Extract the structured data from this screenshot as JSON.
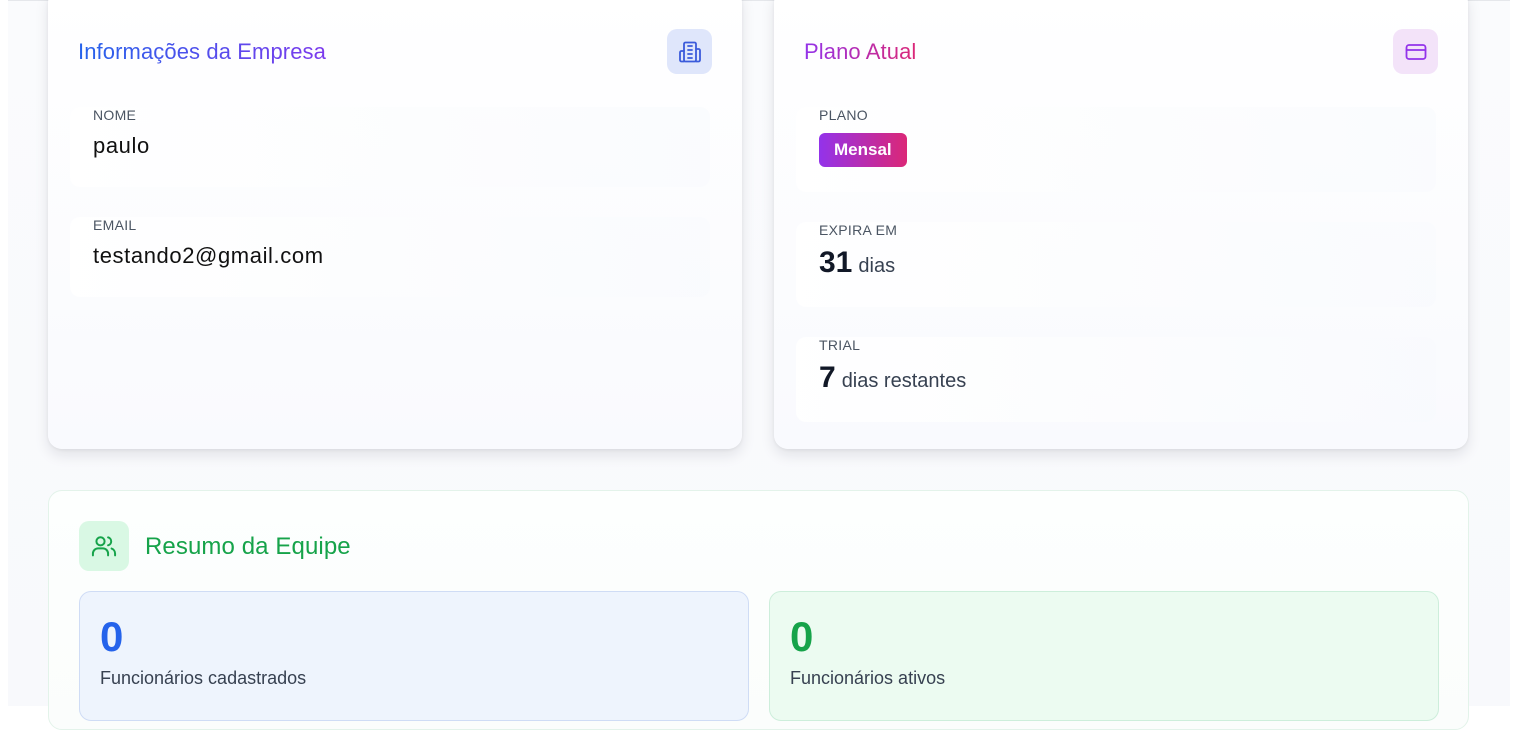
{
  "company": {
    "title": "Informações da Empresa",
    "icon": "building-icon",
    "name_label": "NOME",
    "name_value": "paulo",
    "email_label": "EMAIL",
    "email_value": "testando2@gmail.com"
  },
  "plan": {
    "title": "Plano Atual",
    "icon": "credit-card-icon",
    "plan_label": "PLANO",
    "plan_value": "Mensal",
    "expires_label": "EXPIRA EM",
    "expires_value": "31",
    "expires_unit": "dias",
    "trial_label": "TRIAL",
    "trial_value": "7",
    "trial_unit": "dias restantes"
  },
  "team": {
    "title": "Resumo da Equipe",
    "icon": "users-icon",
    "registered_value": "0",
    "registered_label": "Funcionários cadastrados",
    "active_value": "0",
    "active_label": "Funcionários ativos"
  },
  "colors": {
    "company_accent": "#2563eb",
    "plan_accent": "#9333ea",
    "plan_accent_2": "#db2777",
    "team_accent": "#16a34a"
  }
}
